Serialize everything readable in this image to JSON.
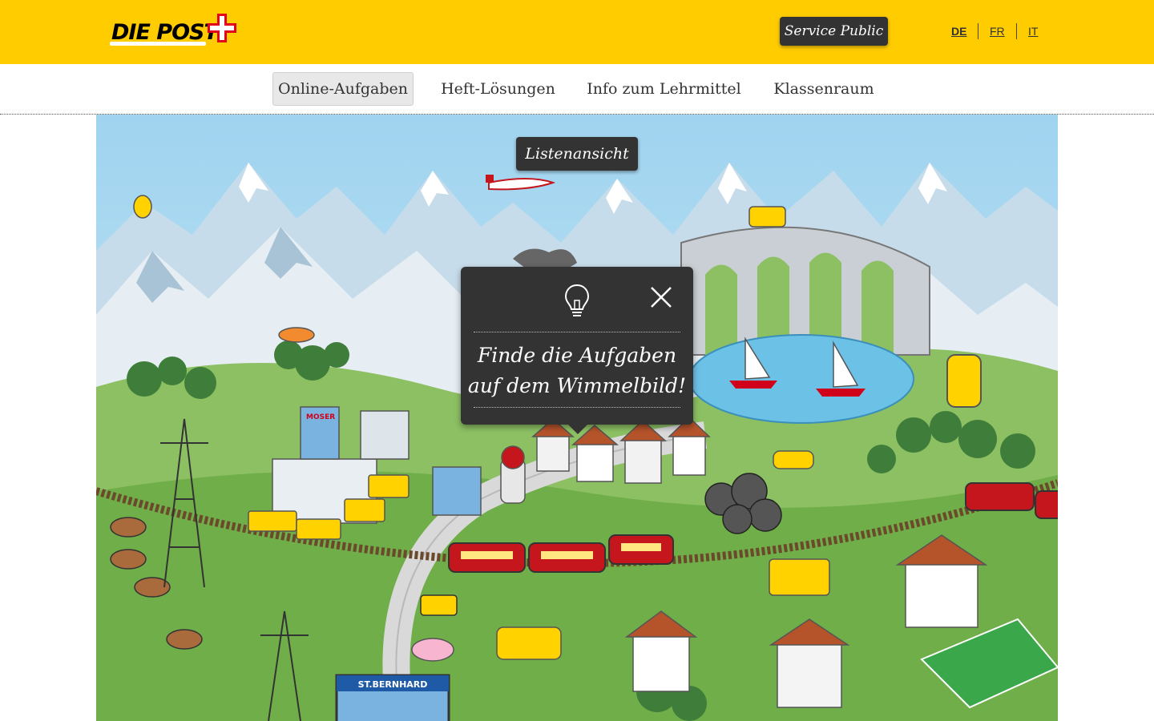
{
  "header": {
    "logo_text": "DIE POST",
    "service_public_label": "Service Public",
    "languages": [
      {
        "code": "DE",
        "active": true
      },
      {
        "code": "FR",
        "active": false
      },
      {
        "code": "IT",
        "active": false
      }
    ]
  },
  "nav": {
    "items": [
      {
        "label": "Online-Aufgaben",
        "active": true
      },
      {
        "label": "Heft-Lösungen",
        "active": false
      },
      {
        "label": "Info zum Lehrmittel",
        "active": false
      },
      {
        "label": "Klassenraum",
        "active": false
      }
    ]
  },
  "scene": {
    "list_view_label": "Listenansicht",
    "billboard_text": "ST.BERNHARD",
    "building_sign": "MOSER"
  },
  "popup": {
    "line1": "Finde die Aufgaben",
    "line2": "auf dem Wimmelbild!",
    "icon": "lightbulb-icon",
    "close_icon": "close-icon"
  },
  "colors": {
    "brand_yellow": "#ffcc00",
    "brand_red": "#e2001a",
    "dark": "#333333"
  }
}
